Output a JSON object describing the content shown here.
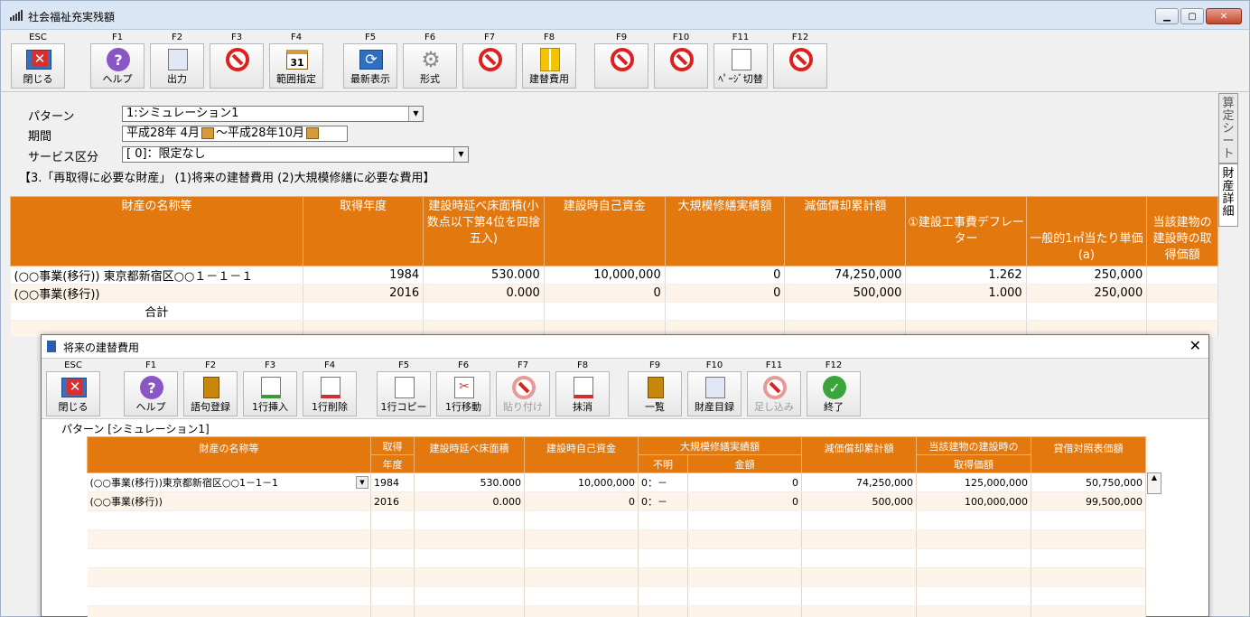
{
  "window": {
    "title": "社会福祉充実残額"
  },
  "toolbar": [
    {
      "key": "ESC",
      "label": "閉じる",
      "icon": "close-icon"
    },
    {
      "key": "F1",
      "label": "ヘルプ",
      "icon": "help-icon"
    },
    {
      "key": "F2",
      "label": "出力",
      "icon": "output-icon"
    },
    {
      "key": "F3",
      "label": "",
      "icon": "no-entry-icon"
    },
    {
      "key": "F4",
      "label": "範囲指定",
      "icon": "calendar-icon"
    },
    {
      "key": "F5",
      "label": "最新表示",
      "icon": "refresh-icon"
    },
    {
      "key": "F6",
      "label": "形式",
      "icon": "gear-icon"
    },
    {
      "key": "F7",
      "label": "",
      "icon": "no-entry-icon"
    },
    {
      "key": "F8",
      "label": "建替費用",
      "icon": "binder-icon"
    },
    {
      "key": "F9",
      "label": "",
      "icon": "no-entry-icon"
    },
    {
      "key": "F10",
      "label": "",
      "icon": "no-entry-icon"
    },
    {
      "key": "F11",
      "label": "ﾍﾟｰｼﾞ切替",
      "icon": "page-switch-icon"
    },
    {
      "key": "F12",
      "label": "",
      "icon": "no-entry-icon"
    }
  ],
  "form": {
    "pattern_label": "パターン",
    "pattern_value": "1:シミュレーション1",
    "period_label": "期間",
    "period_from": "平成28年 4月",
    "period_sep": "～",
    "period_to": "平成28年10月",
    "service_label": "サービス区分",
    "service_value": "[      0]：限定なし",
    "note": "【3.「再取得に必要な財産」 (1)将来の建替費用 (2)大規模修繕に必要な費用】"
  },
  "side_tabs": [
    "算定シート",
    "財産詳細"
  ],
  "main_grid": {
    "headers": {
      "name": "財産の名称等",
      "year": "取得年度",
      "area": "建設時延べ床面積(小数点以下第4位を四捨五入)",
      "own_fund": "建設時自己資金",
      "repair": "大規模修繕実績額",
      "depr": "減価償却累計額",
      "deflator": "①建設工事費デフレーター",
      "unit_price": "一般的1㎡当たり単価 (a)",
      "bldg": "当該建物の建設時の取得価額"
    },
    "rows": [
      {
        "name": "(○○事業(移行)) 東京都新宿区○○１－１－１",
        "year": "1984",
        "area": "530.000",
        "own_fund": "10,000,000",
        "repair": "0",
        "depr": "74,250,000",
        "deflator": "1.262",
        "unit_price": "250,000"
      },
      {
        "name": "(○○事業(移行))",
        "year": "2016",
        "area": "0.000",
        "own_fund": "0",
        "repair": "0",
        "depr": "500,000",
        "deflator": "1.000",
        "unit_price": "250,000"
      }
    ],
    "total_label": "合計"
  },
  "dialog": {
    "title": "将来の建替費用",
    "pattern": "パターン [シミュレーション1]",
    "toolbar": [
      {
        "key": "ESC",
        "label": "閉じる",
        "icon": "close-icon",
        "disabled": false
      },
      {
        "key": "F1",
        "label": "ヘルプ",
        "icon": "help-icon",
        "disabled": false
      },
      {
        "key": "F2",
        "label": "語句登録",
        "icon": "book-icon",
        "disabled": false
      },
      {
        "key": "F3",
        "label": "1行挿入",
        "icon": "insert-row-icon",
        "disabled": false
      },
      {
        "key": "F4",
        "label": "1行削除",
        "icon": "delete-row-icon",
        "disabled": false
      },
      {
        "key": "F5",
        "label": "1行コピー",
        "icon": "copy-row-icon",
        "disabled": false
      },
      {
        "key": "F6",
        "label": "1行移動",
        "icon": "move-row-icon",
        "disabled": false
      },
      {
        "key": "F7",
        "label": "貼り付け",
        "icon": "paste-icon",
        "disabled": true
      },
      {
        "key": "F8",
        "label": "抹消",
        "icon": "erase-icon",
        "disabled": false
      },
      {
        "key": "F9",
        "label": "一覧",
        "icon": "list-icon",
        "disabled": false
      },
      {
        "key": "F10",
        "label": "財産目録",
        "icon": "inventory-icon",
        "disabled": false
      },
      {
        "key": "F11",
        "label": "足し込み",
        "icon": "add-in-icon",
        "disabled": true
      },
      {
        "key": "F12",
        "label": "終了",
        "icon": "check-icon",
        "disabled": false
      }
    ],
    "headers": {
      "name": "財産の名称等",
      "year1": "取得",
      "year2": "年度",
      "area": "建設時延べ床面積",
      "own_fund": "建設時自己資金",
      "repair": "大規模修繕実績額",
      "unknown": "不明",
      "amount": "金額",
      "depr": "減価償却累計額",
      "bldg1": "当該建物の建設時の",
      "bldg2": "取得価額",
      "book": "貸借対照表価額"
    },
    "rows": [
      {
        "name": "(○○事業(移行))東京都新宿区○○1－1－1",
        "year": "1984",
        "area": "530.000",
        "own_fund": "10,000,000",
        "unknown": "0：－",
        "amount": "0",
        "depr": "74,250,000",
        "bldg": "125,000,000",
        "book": "50,750,000"
      },
      {
        "name": "(○○事業(移行))",
        "year": "2016",
        "area": "0.000",
        "own_fund": "0",
        "unknown": "0：－",
        "amount": "0",
        "depr": "500,000",
        "bldg": "100,000,000",
        "book": "99,500,000"
      }
    ]
  }
}
